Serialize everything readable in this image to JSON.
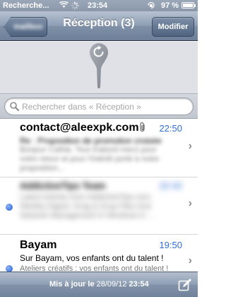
{
  "status_bar": {
    "carrier": "Recherche...",
    "time": "23:54",
    "battery_text": "97 %",
    "battery_level": 0.97
  },
  "nav": {
    "back_label": "mailbox",
    "title": "Réception (3)",
    "edit_label": "Modifier"
  },
  "search": {
    "placeholder": "Rechercher dans « Réception »"
  },
  "messages": [
    {
      "sender": "contact@aleexpk.com",
      "time": "22:50",
      "subject": "Re : Proposition de promotion croisée",
      "preview": "Bonjour Cathie, Tout d'abord merci pour votre retour et pour l'intérêt porté à notre proposition...",
      "unread": false,
      "attachment": true
    },
    {
      "sender": "AddictiveTips Team",
      "time": "22:42",
      "subject": "",
      "preview": "Latest Articles from AddictiveTips.com Weekly Digest: Drag & Drop Files And Network Management In Windows 8 ...",
      "unread": true,
      "attachment": false
    },
    {
      "sender": "Bayam",
      "time": "19:50",
      "subject": "Sur Bayam, vos enfants ont du talent !",
      "preview": "Ateliers créatifs : vos enfants ont du talent !",
      "unread": true,
      "attachment": false
    }
  ],
  "toolbar": {
    "updated_label": "Mis à jour le",
    "updated_date": "28/09/12",
    "updated_time": "23:54"
  },
  "colors": {
    "accent_time": "#2f6fd6",
    "unread_dot": "#1f5bd6",
    "nav_bar": "#8d9db3"
  }
}
